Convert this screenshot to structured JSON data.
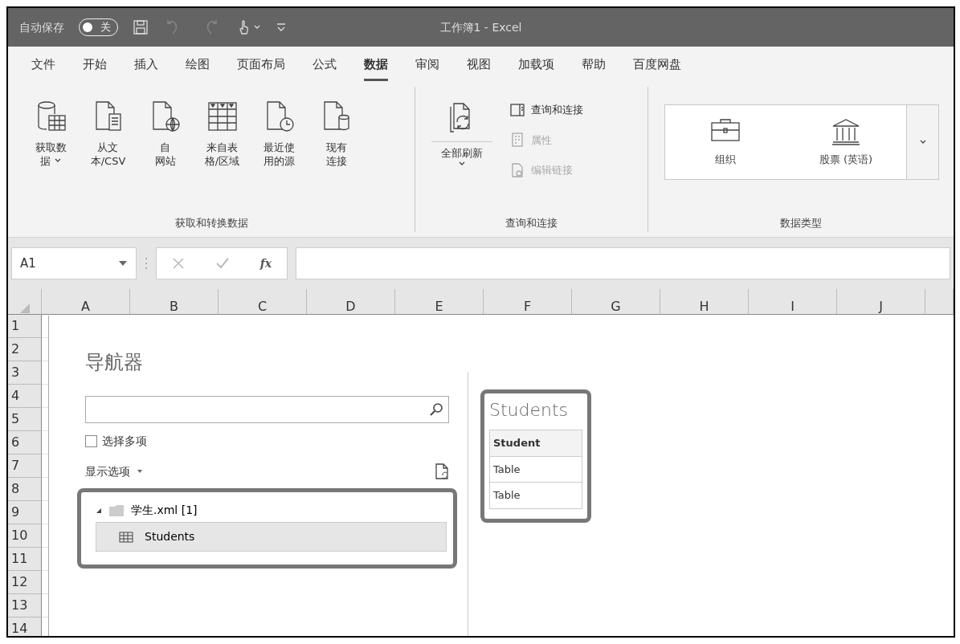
{
  "title_bar": {
    "autosave_label": "自动保存",
    "autosave_toggle": {
      "label": "关",
      "on": false
    },
    "title": "工作簿1 - Excel"
  },
  "tabs": [
    {
      "label": "文件",
      "selected": false
    },
    {
      "label": "开始",
      "selected": false
    },
    {
      "label": "插入",
      "selected": false
    },
    {
      "label": "绘图",
      "selected": false
    },
    {
      "label": "页面布局",
      "selected": false
    },
    {
      "label": "公式",
      "selected": false
    },
    {
      "label": "数据",
      "selected": true
    },
    {
      "label": "审阅",
      "selected": false
    },
    {
      "label": "视图",
      "selected": false
    },
    {
      "label": "加载项",
      "selected": false
    },
    {
      "label": "帮助",
      "selected": false
    },
    {
      "label": "百度网盘",
      "selected": false
    }
  ],
  "ribbon": {
    "groups": [
      {
        "kind": "large",
        "label": "获取和转换数据",
        "buttons": [
          {
            "label_lines": [
              "获取数",
              "据"
            ],
            "has_menu": true
          },
          {
            "label_lines": [
              "从文",
              "本/CSV"
            ],
            "has_menu": false
          },
          {
            "label_lines": [
              "自",
              "网站"
            ],
            "has_menu": false
          },
          {
            "label_lines": [
              "来自表",
              "格/区域"
            ],
            "has_menu": false
          },
          {
            "label_lines": [
              "最近使",
              "用的源"
            ],
            "has_menu": false
          },
          {
            "label_lines": [
              "现有",
              "连接"
            ],
            "has_menu": false
          }
        ]
      },
      {
        "kind": "query",
        "label": "查询和连接",
        "refresh": {
          "label": "全部刷新",
          "has_menu": true
        },
        "buttons": [
          {
            "label": "查询和连接",
            "disabled": false
          },
          {
            "label": "属性",
            "disabled": true
          },
          {
            "label": "编辑链接",
            "disabled": true
          }
        ]
      },
      {
        "kind": "gallery",
        "label": "数据类型",
        "items": [
          {
            "label": "组织"
          },
          {
            "label": "股票 (英语)"
          }
        ]
      }
    ]
  },
  "formula_bar": {
    "name_box": "A1",
    "fx_label": "fx"
  },
  "sheet": {
    "columns": [
      "A",
      "B",
      "C",
      "D",
      "E",
      "F",
      "G",
      "H",
      "I",
      "J"
    ],
    "rows": [
      "1",
      "2",
      "3",
      "4",
      "5",
      "6",
      "7",
      "8",
      "9",
      "10",
      "11",
      "12",
      "13",
      "14"
    ]
  },
  "navigator": {
    "title": "导航器",
    "multi_select": {
      "label": "选择多项",
      "checked": false
    },
    "display_options": "显示选项",
    "tree": [
      {
        "label": "学生.xml [1]",
        "expanded": true,
        "children": [
          {
            "label": "Students",
            "selected": true
          }
        ]
      }
    ],
    "preview": {
      "title": "Students",
      "columns": [
        "Student"
      ],
      "rows": [
        [
          "Table"
        ],
        [
          "Table"
        ]
      ]
    }
  }
}
